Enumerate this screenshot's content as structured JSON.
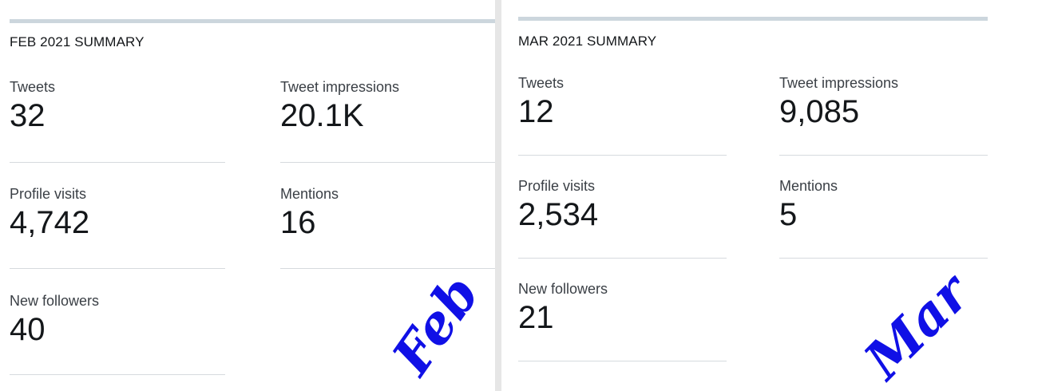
{
  "feb": {
    "title": "FEB 2021 SUMMARY",
    "tweets": {
      "label": "Tweets",
      "value": "32"
    },
    "impressions": {
      "label": "Tweet impressions",
      "value": "20.1K"
    },
    "profile_visits": {
      "label": "Profile visits",
      "value": "4,742"
    },
    "mentions": {
      "label": "Mentions",
      "value": "16"
    },
    "new_followers": {
      "label": "New followers",
      "value": "40"
    },
    "annotation": "Feb"
  },
  "mar": {
    "title": "MAR 2021 SUMMARY",
    "tweets": {
      "label": "Tweets",
      "value": "12"
    },
    "impressions": {
      "label": "Tweet impressions",
      "value": "9,085"
    },
    "profile_visits": {
      "label": "Profile visits",
      "value": "2,534"
    },
    "mentions": {
      "label": "Mentions",
      "value": "5"
    },
    "new_followers": {
      "label": "New followers",
      "value": "21"
    },
    "annotation": "Mar"
  },
  "colors": {
    "annotation": "#1010e6",
    "divider": "#d6dade",
    "top_bar": "#ccd6dd",
    "background": "#e6e6e6"
  }
}
